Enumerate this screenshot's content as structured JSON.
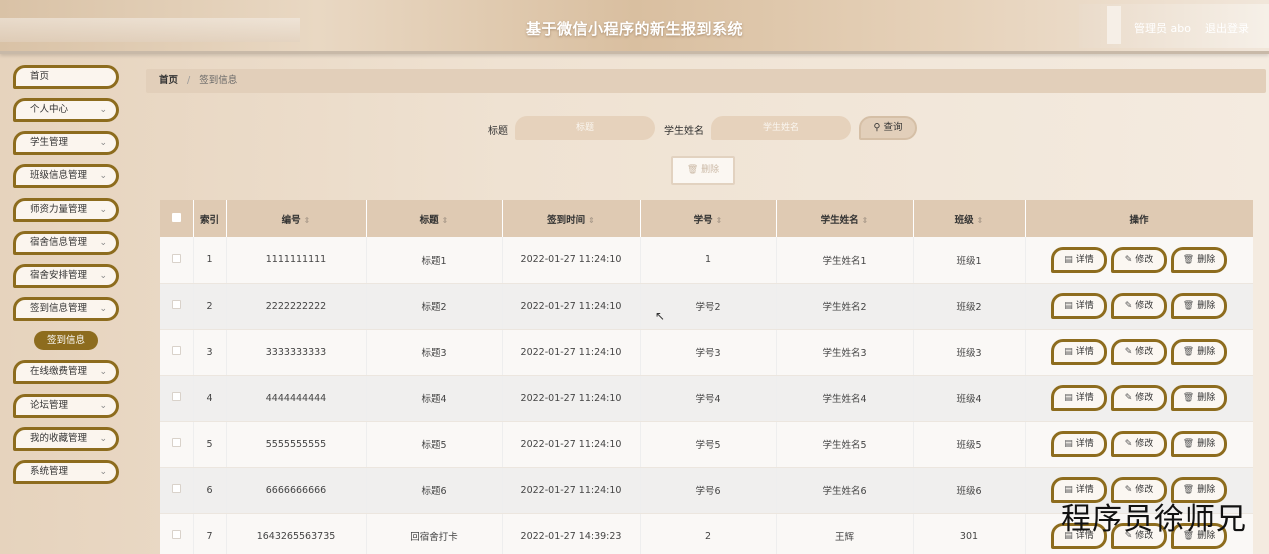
{
  "header": {
    "title": "基于微信小程序的新生报到系统",
    "user": "管理员 abo",
    "logout": "退出登录"
  },
  "sidebar": {
    "items": [
      {
        "label": "首页",
        "has_arrow": false
      },
      {
        "label": "个人中心",
        "has_arrow": true
      },
      {
        "label": "学生管理",
        "has_arrow": true
      },
      {
        "label": "班级信息管理",
        "has_arrow": true
      },
      {
        "label": "师资力量管理",
        "has_arrow": true
      },
      {
        "label": "宿舍信息管理",
        "has_arrow": true
      },
      {
        "label": "宿舍安排管理",
        "has_arrow": true
      },
      {
        "label": "签到信息管理",
        "has_arrow": true
      },
      {
        "label": "在线缴费管理",
        "has_arrow": true
      },
      {
        "label": "论坛管理",
        "has_arrow": true
      },
      {
        "label": "我的收藏管理",
        "has_arrow": true
      },
      {
        "label": "系统管理",
        "has_arrow": true
      }
    ],
    "active_sub": "签到信息"
  },
  "breadcrumb": {
    "home": "首页",
    "separator": "/",
    "current": "签到信息"
  },
  "search": {
    "title_label": "标题",
    "title_placeholder": "标题",
    "name_label": "学生姓名",
    "name_placeholder": "学生姓名",
    "search_button": "查询",
    "delete_button": "删除"
  },
  "table": {
    "headers": [
      "索引",
      "编号",
      "标题",
      "签到时间",
      "学号",
      "学生姓名",
      "班级",
      "操作"
    ],
    "rows": [
      {
        "index": "1",
        "code": "1111111111",
        "title": "标题1",
        "time": "2022-01-27 11:24:10",
        "student_no": "1",
        "name": "学生姓名1",
        "class": "班级1"
      },
      {
        "index": "2",
        "code": "2222222222",
        "title": "标题2",
        "time": "2022-01-27 11:24:10",
        "student_no": "学号2",
        "name": "学生姓名2",
        "class": "班级2"
      },
      {
        "index": "3",
        "code": "3333333333",
        "title": "标题3",
        "time": "2022-01-27 11:24:10",
        "student_no": "学号3",
        "name": "学生姓名3",
        "class": "班级3"
      },
      {
        "index": "4",
        "code": "4444444444",
        "title": "标题4",
        "time": "2022-01-27 11:24:10",
        "student_no": "学号4",
        "name": "学生姓名4",
        "class": "班级4"
      },
      {
        "index": "5",
        "code": "5555555555",
        "title": "标题5",
        "time": "2022-01-27 11:24:10",
        "student_no": "学号5",
        "name": "学生姓名5",
        "class": "班级5"
      },
      {
        "index": "6",
        "code": "6666666666",
        "title": "标题6",
        "time": "2022-01-27 11:24:10",
        "student_no": "学号6",
        "name": "学生姓名6",
        "class": "班级6"
      },
      {
        "index": "7",
        "code": "1643265563735",
        "title": "回宿舍打卡",
        "time": "2022-01-27 14:39:23",
        "student_no": "2",
        "name": "王辉",
        "class": "301"
      }
    ],
    "actions": {
      "detail": "详情",
      "edit": "修改",
      "delete": "删除"
    }
  },
  "icons": {
    "detail": "document-icon",
    "edit": "pencil-icon",
    "delete": "trash-icon",
    "search": "search-icon",
    "chevron": "chevron-down-icon"
  },
  "colors": {
    "accent": "#8d6c1e",
    "header_bg": "#dfcab3"
  },
  "watermark": "程序员徐师兄"
}
